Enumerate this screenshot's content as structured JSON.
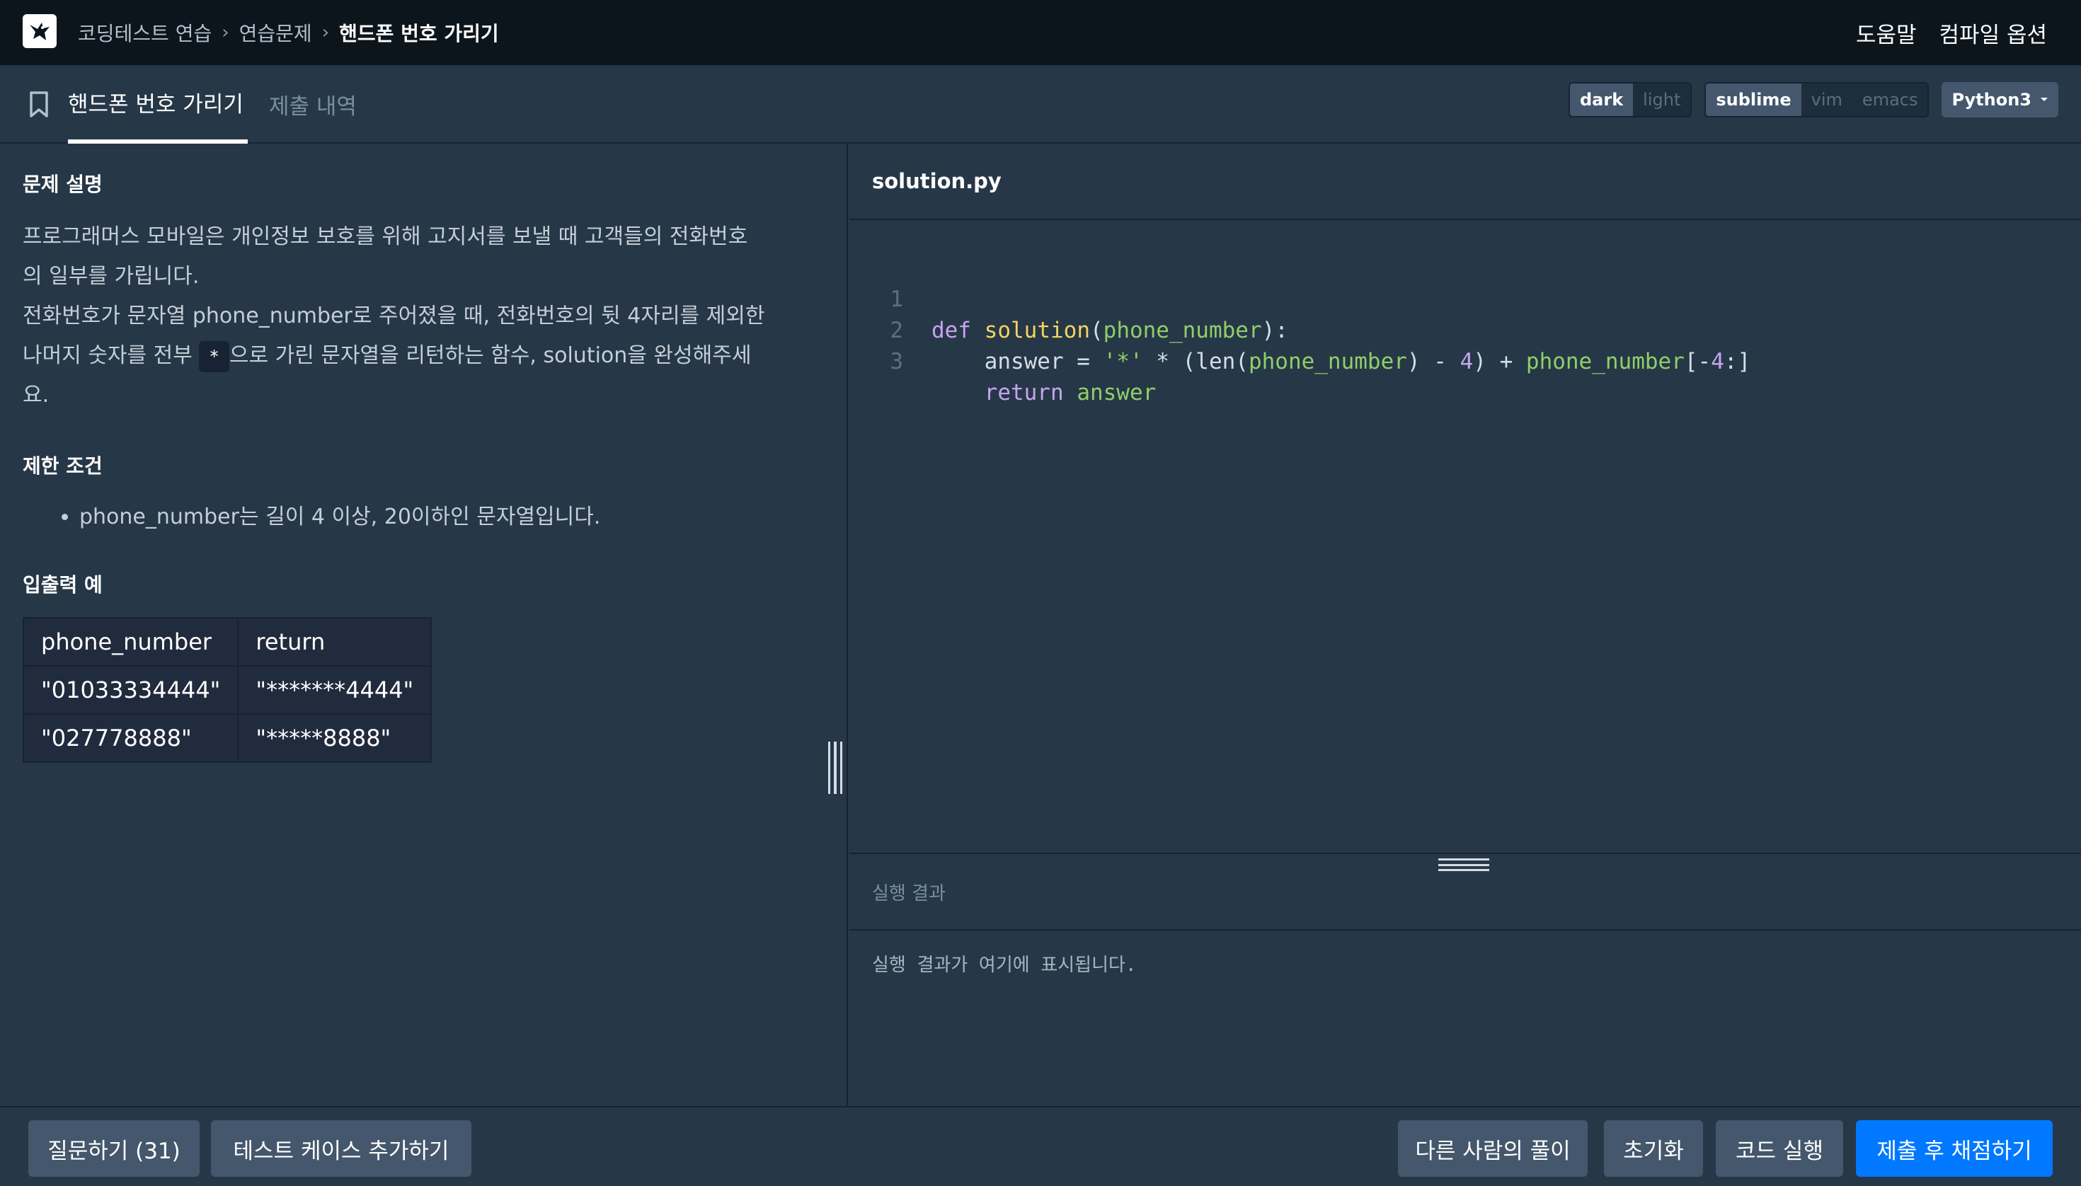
{
  "nav": {
    "breadcrumbs": [
      "코딩테스트 연습",
      "연습문제",
      "핸드폰 번호 가리기"
    ],
    "help": "도움말",
    "compile_options": "컴파일 옵션"
  },
  "tabs": {
    "problem": "핸드폰 번호 가리기",
    "submissions": "제출 내역"
  },
  "editor_options": {
    "themes": [
      "dark",
      "light"
    ],
    "selected_theme": "dark",
    "keymaps": [
      "sublime",
      "vim",
      "emacs"
    ],
    "selected_keymap": "sublime",
    "language": "Python3"
  },
  "problem": {
    "desc_title": "문제 설명",
    "desc_line1": "프로그래머스 모바일은 개인정보 보호를 위해 고지서를 보낼 때 고객들의 전화번호",
    "desc_line2": "의 일부를 가립니다.",
    "desc_line3": "전화번호가 문자열 phone_number로 주어졌을 때, 전화번호의 뒷 4자리를 제외한",
    "desc_line4_a": "나머지 숫자를 전부",
    "desc_line4_code": "*",
    "desc_line4_b": "으로 가린 문자열을 리턴하는 함수, solution을 완성해주세",
    "desc_line5": "요.",
    "limits_title": "제한 조건",
    "limits": [
      "phone_number는 길이 4 이상, 20이하인 문자열입니다."
    ],
    "io_title": "입출력 예",
    "io_table": {
      "headers": [
        "phone_number",
        "return"
      ],
      "rows": [
        [
          "\"01033334444\"",
          "\"*******4444\""
        ],
        [
          "\"027778888\"",
          "\"*****8888\""
        ]
      ]
    }
  },
  "editor": {
    "filename": "solution.py",
    "lines": [
      "def solution(phone_number):",
      "    answer = '*' * (len(phone_number) - 4) + phone_number[-4:]",
      "    return answer"
    ]
  },
  "result": {
    "title": "실행 결과",
    "placeholder": "실행 결과가 여기에 표시됩니다."
  },
  "buttons": {
    "question": "질문하기 (31)",
    "add_test_case": "테스트 케이스 추가하기",
    "others_solutions": "다른 사람의 풀이",
    "reset": "초기화",
    "run": "코드 실행",
    "submit": "제출 후 채점하기"
  }
}
